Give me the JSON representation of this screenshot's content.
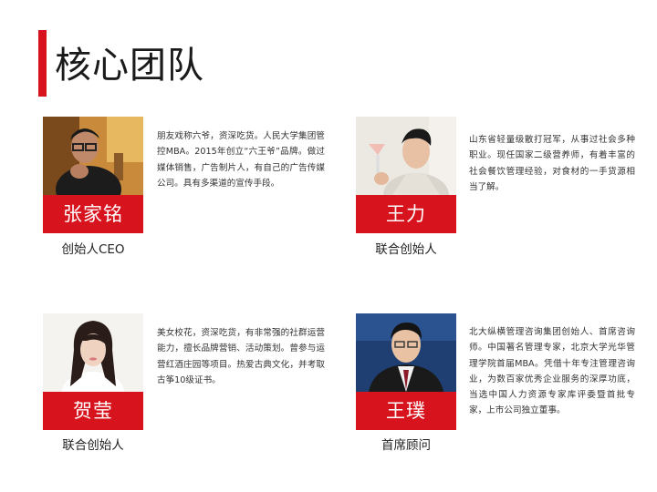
{
  "page": {
    "title": "核心团队",
    "accent_color": "#d7141e"
  },
  "members": [
    {
      "name": "张家铭",
      "role": "创始人CEO",
      "description": "朋友戏称六爷，资深吃货。人民大学集团管控MBA。2015年创立“六王爷”品牌。做过媒体销售，广告制片人，有自己的广告传媒公司。具有多渠道的宣传手段。"
    },
    {
      "name": "王力",
      "role": "联合创始人",
      "description": "山东省轻量级散打冠军，从事过社会多种职业。现任国家二级营养师，有着丰富的社会餐饮管理经验，对食材的一手货源相当了解。"
    },
    {
      "name": "贺莹",
      "role": "联合创始人",
      "description": "美女校花，资深吃货，有非常强的社群运营能力，擅长品牌营销、活动策划。曾参与运营红酒庄园等项目。热爱古典文化，并考取古筝10级证书。"
    },
    {
      "name": "王璞",
      "role": "首席顾问",
      "description": "北大纵横管理咨询集团创始人、首席咨询师。中国著名管理专家，北京大学光华管理学院首届MBA。凭借十年专注管理咨询业，为数百家优秀企业服务的深厚功底，当选中国人力资源专家库评委暨首批专家，上市公司独立董事。"
    }
  ]
}
